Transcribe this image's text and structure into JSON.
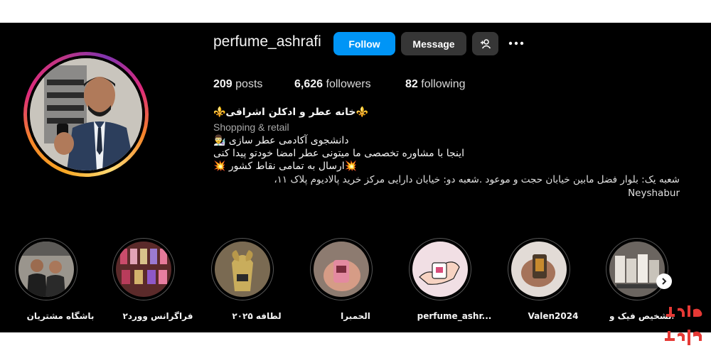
{
  "profile": {
    "username": "perfume_ashrafi",
    "follow_label": "Follow",
    "message_label": "Message",
    "add_user_icon": "add-user-icon",
    "more_icon": "more-icon"
  },
  "stats": {
    "posts_count": "209",
    "posts_label": "posts",
    "followers_count": "6,626",
    "followers_label": "followers",
    "following_count": "82",
    "following_label": "following"
  },
  "bio": {
    "name": "⚜️خانه عطر و ادکلن اشرافی⚜️",
    "category": "Shopping & retail",
    "line1": "دانشجوی آکادمی عطر سازی 👨‍🔬",
    "line2": "اینجا با مشاوره تخصصی ما میتونی عطر امضا خودتو پیدا کنی",
    "line3": "💥ارسال به تمامی نقاط کشور 💥",
    "line4": "شعبه یک: بلوار فضل مابین خیابان حجت و موعود .شعبه دو: خیابان دارایی مرکز خرید پالادیوم پلاک ۱۱،",
    "line5": "Neyshabur"
  },
  "highlights": [
    {
      "label": "باشگاه مشتریان"
    },
    {
      "label": "فراگرانس وورد۲"
    },
    {
      "label": "لطافه ۲۰۲۵"
    },
    {
      "label": "الحمبرا"
    },
    {
      "label": "perfume_ashr..."
    },
    {
      "label": "Valen2024"
    },
    {
      "label": "تشخیص فیک و..."
    }
  ],
  "nav": {
    "next_icon": "chevron-right-icon"
  },
  "watermark": {
    "text_line1": "کافه",
    "text_line2": "کارا",
    "color": "#e53935"
  },
  "colors": {
    "follow": "#0095f6",
    "button_dark": "#363636",
    "background": "#000000"
  }
}
